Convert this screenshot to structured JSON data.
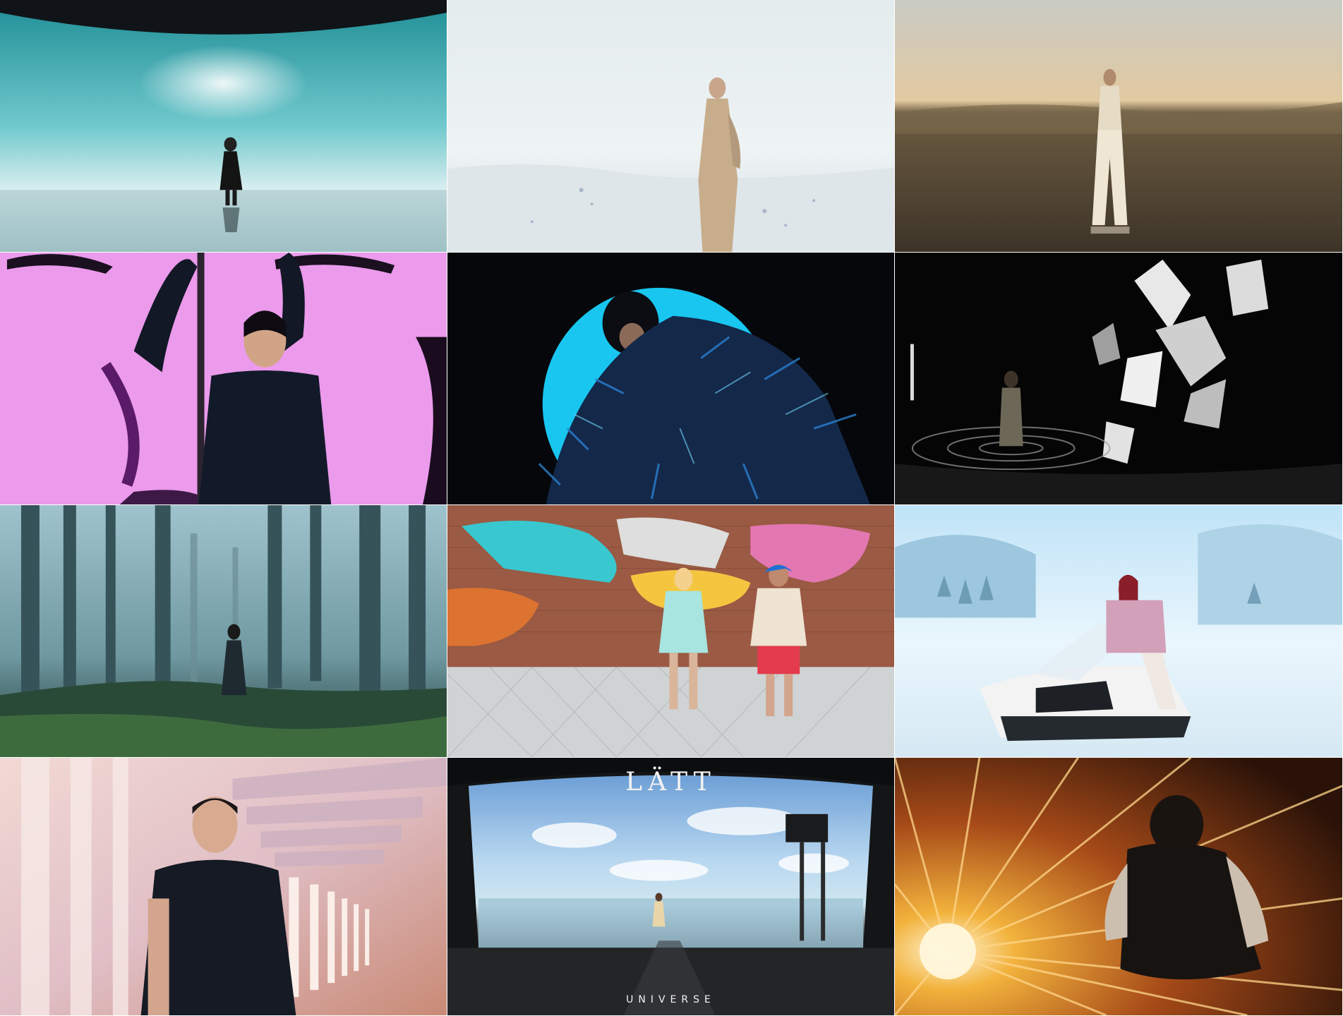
{
  "tiles": [
    {
      "scene": "figure-on-reflective-stage-teal-sky"
    },
    {
      "scene": "figure-in-white-mist"
    },
    {
      "scene": "figure-in-desert-dunes"
    },
    {
      "scene": "woman-before-pink-face-backdrop"
    },
    {
      "scene": "figure-in-blue-fringe-coat"
    },
    {
      "scene": "figure-with-white-abstract-shapes"
    },
    {
      "scene": "figure-in-foggy-forest"
    },
    {
      "scene": "two-women-by-graffiti-wall"
    },
    {
      "scene": "woman-on-snowmobile"
    },
    {
      "scene": "woman-in-light-corridor"
    },
    {
      "scene": "studio-led-stage-sky",
      "title": "LÄTT",
      "subtitle": "UNIVERSE"
    },
    {
      "scene": "figure-in-light-speed-streaks"
    }
  ],
  "colors": {
    "teal": "#2aa0a8",
    "mist": "#e6ecef",
    "desert": "#8a7455",
    "pink": "#e07ce8",
    "cyan": "#15c4f0",
    "snow": "#dff0fb",
    "amber": "#e89a2c"
  }
}
